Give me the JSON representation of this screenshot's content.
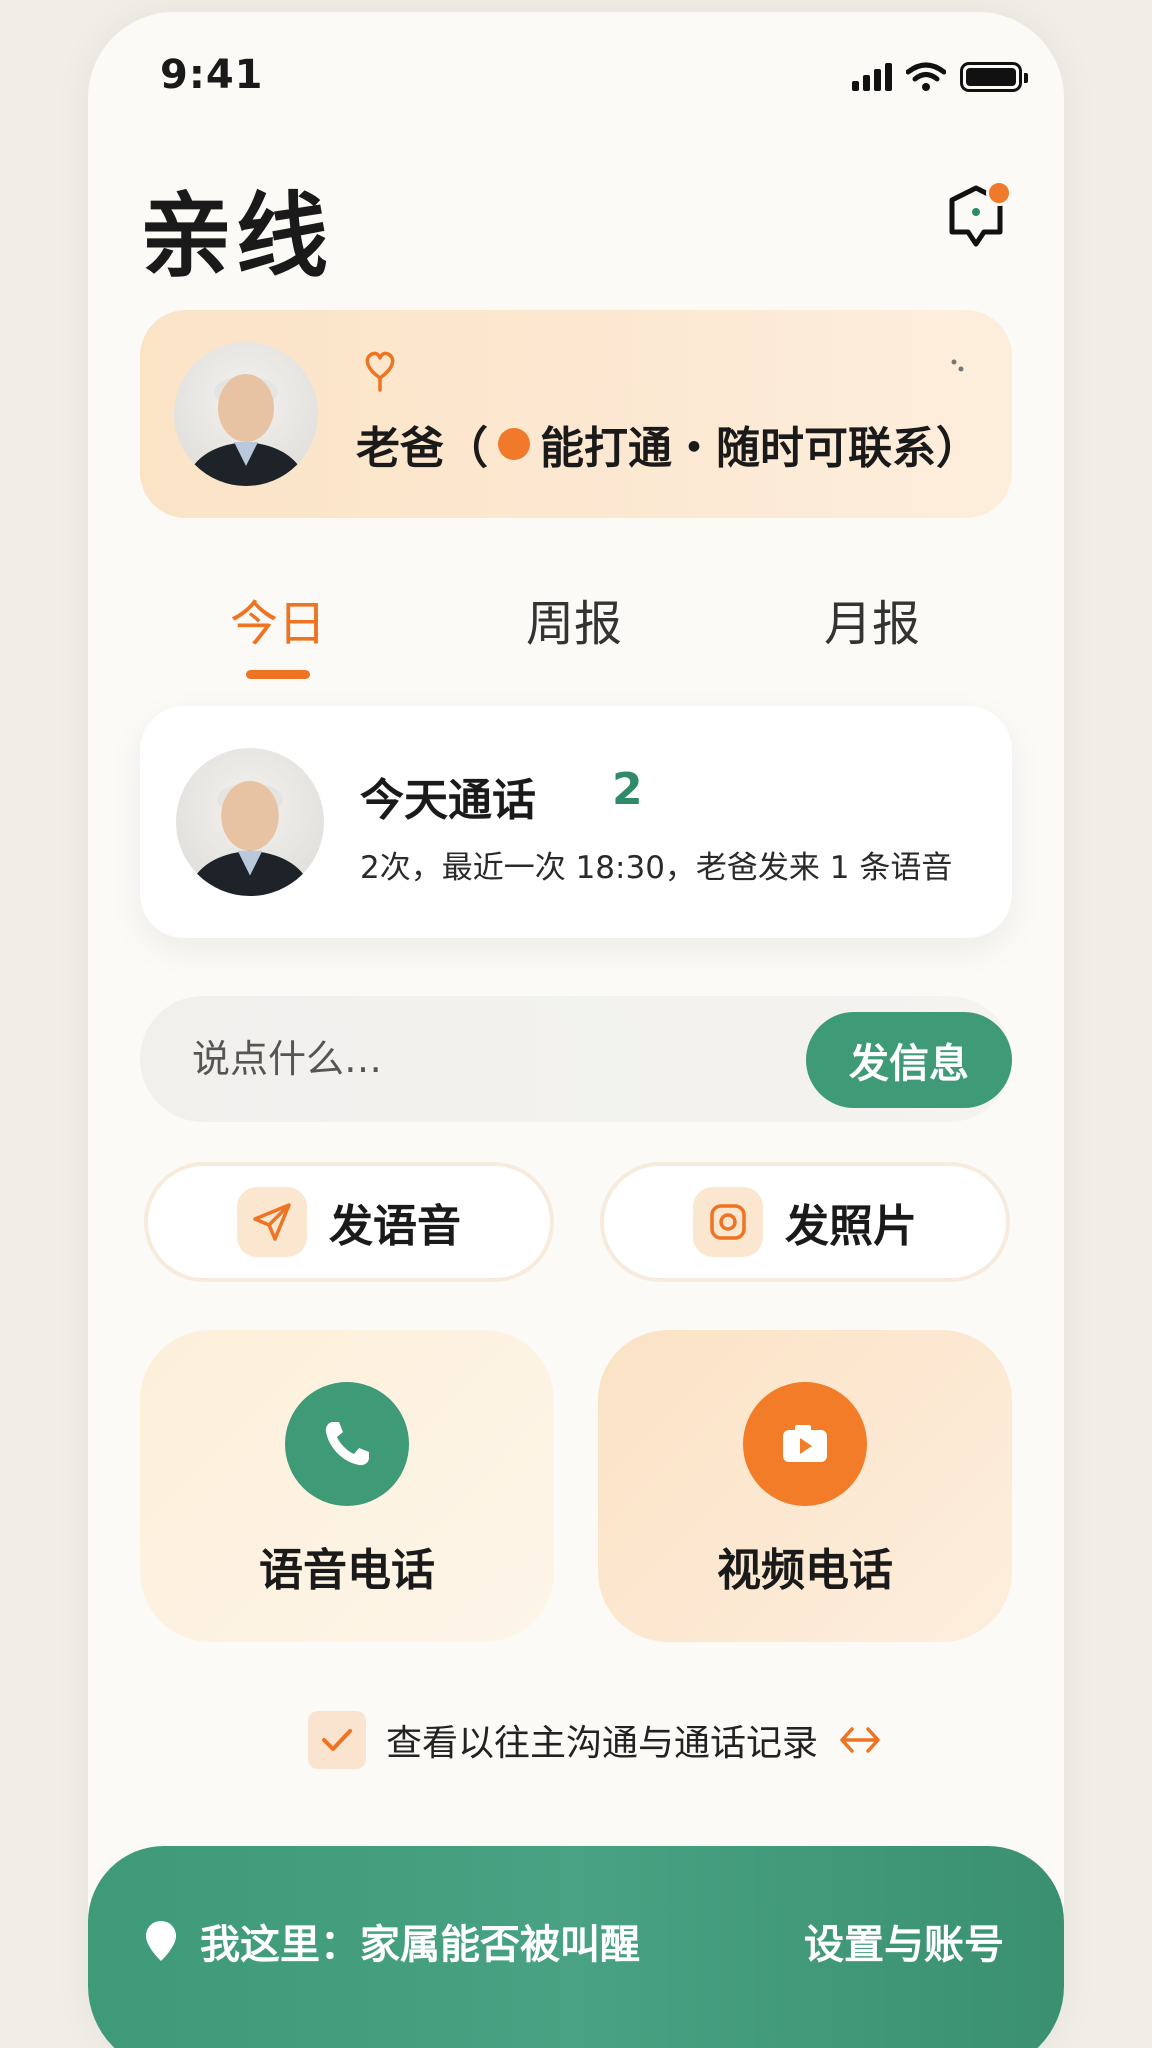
{
  "status_bar": {
    "time": "9:41"
  },
  "header": {
    "title": "亲线"
  },
  "contact": {
    "name": "老爸",
    "open_paren": "（",
    "status": "能打通・随时可联系",
    "close_paren": "）",
    "status_color": "#f07a2a"
  },
  "tabs": [
    {
      "label": "今日",
      "active": true
    },
    {
      "label": "周报",
      "active": false
    },
    {
      "label": "月报",
      "active": false
    }
  ],
  "summary": {
    "title": "今天通话",
    "count": "2",
    "detail": "2次，最近一次 18:30，老爸发来 1 条语音"
  },
  "message": {
    "placeholder": "说点什么…",
    "send_label": "发信息"
  },
  "quick_actions": {
    "voice_msg_label": "发语音",
    "photo_label": "发照片"
  },
  "calls": {
    "voice_label": "语音电话",
    "video_label": "视频电话"
  },
  "history": {
    "label": "查看以往主沟通与通话记录"
  },
  "bottom": {
    "left_label": "我这里：家属能否被叫醒",
    "right_label": "设置与账号"
  },
  "colors": {
    "accent_orange": "#ee7322",
    "accent_green": "#3f9a77",
    "banner_bg": "#fbe3c6"
  },
  "icons": {
    "notification": "bell-badge-icon",
    "heart": "heart-balloon-icon",
    "send_voice": "paper-plane-icon",
    "photo": "camera-square-icon",
    "voice_call": "phone-icon",
    "video_call": "video-play-icon",
    "history": "checkmark-icon",
    "link_arrow": "double-arrow-icon",
    "location": "location-pin-icon"
  }
}
